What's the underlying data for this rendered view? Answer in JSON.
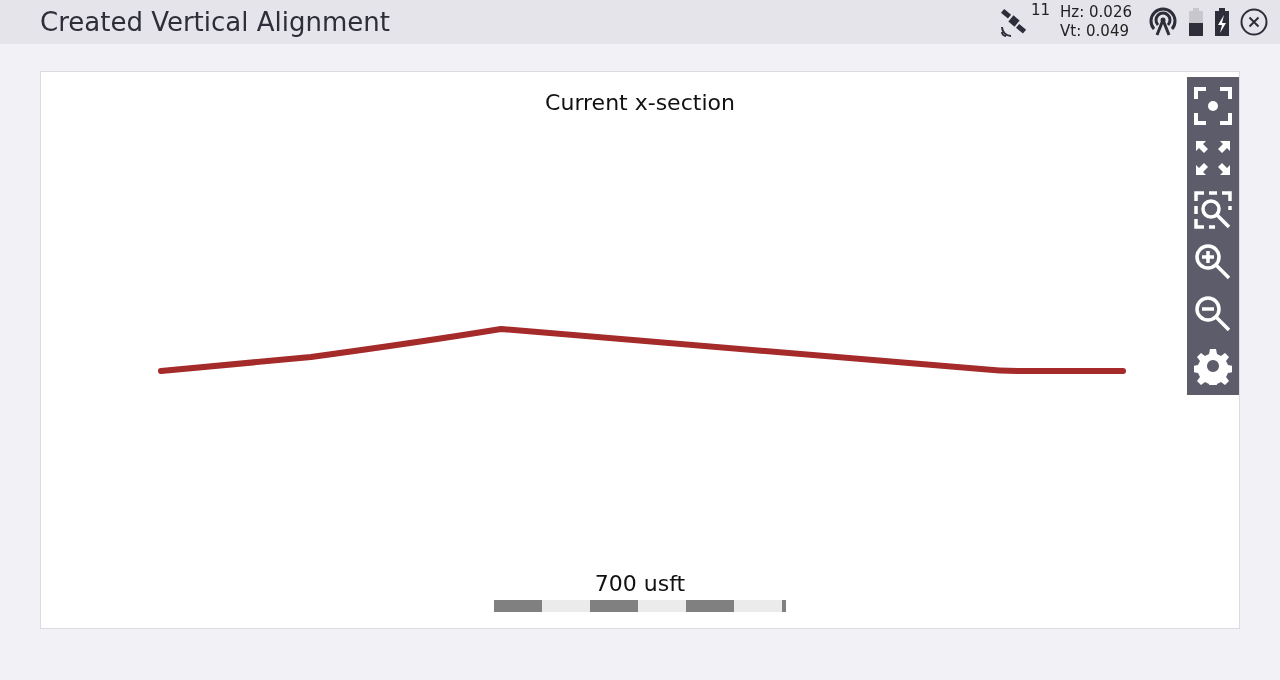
{
  "window": {
    "title": "Created Vertical Alignment"
  },
  "status": {
    "satellites": "11",
    "hz": "Hz: 0.026",
    "vt": "Vt: 0.049"
  },
  "view": {
    "title": "Current x-section",
    "scale_label": "700 usft",
    "toolbar": [
      {
        "kind": "center"
      },
      {
        "kind": "extents"
      },
      {
        "kind": "zoom-window"
      },
      {
        "kind": "zoom-in"
      },
      {
        "kind": "zoom-out"
      },
      {
        "kind": "settings"
      }
    ]
  }
}
